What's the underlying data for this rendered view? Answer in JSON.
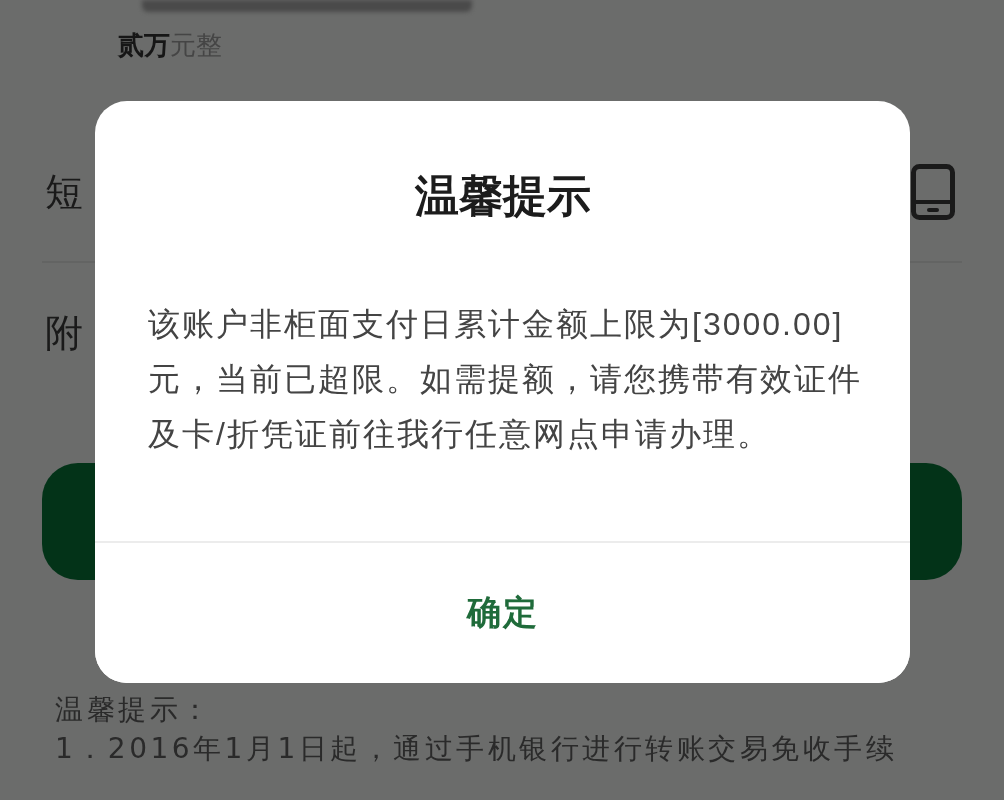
{
  "page": {
    "amount_in_words": "**贰万**元整",
    "form_rows": [
      {
        "label": "短",
        "kind": "icon"
      },
      {
        "label": "附",
        "kind": "text"
      }
    ]
  },
  "dialog": {
    "title": "温馨提示",
    "message": "该账户非柜面支付日累计金额上限为[3000.00]元，当前已超限。如需提额，请您携带有效证件及卡/折凭证前往我行任意网点申请办理。",
    "button": "确定"
  },
  "notes": {
    "heading": "温馨提示：",
    "lines": [
      "1．2016年1月1日起，通过手机银行进行转账交易免收手续"
    ]
  }
}
